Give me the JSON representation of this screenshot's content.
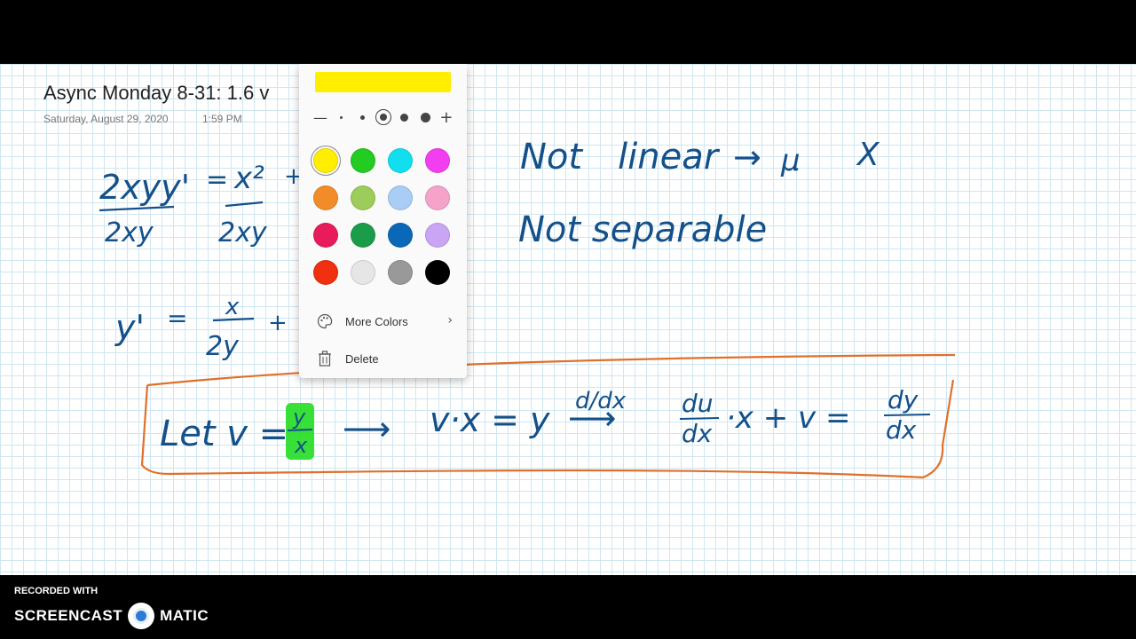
{
  "page": {
    "title": "Async Monday 8-31: 1.6 v",
    "date": "Saturday, August 29, 2020",
    "time": "1:59 PM"
  },
  "ink": {
    "eq1_left": "2xyy'",
    "eq1_eq": "=",
    "eq1_right": "x²",
    "eq1_plus": "+",
    "eq1_den_left": "2xy",
    "eq1_den_right": "2xy",
    "eq2_left": "y'",
    "eq2_eq": "=",
    "eq2_num": "x",
    "eq2_den": "2y",
    "eq2_plus": "+",
    "note1_a": "Not",
    "note1_b": "linear",
    "note1_arrow": "→",
    "note1_mu": "μ",
    "note1_x": "X",
    "note2": "Not separable",
    "box_let": "Let v =",
    "box_y": "y",
    "box_x": "x",
    "box_arrow1": "⟶",
    "box_vx": "v·x = y",
    "box_ddx": "d/dx",
    "box_arrow2": "⟶",
    "box_du": "du",
    "box_dx1": "dx",
    "box_rest": "·x + v =",
    "box_dy": "dy",
    "box_dx2": "dx"
  },
  "pen_picker": {
    "preview_color": "#ffee00",
    "thickness": {
      "decrease": "—",
      "increase": "+",
      "selected_index": 2
    },
    "swatches": [
      {
        "name": "yellow",
        "color": "#ffee00",
        "selected": true
      },
      {
        "name": "green",
        "color": "#22cc22"
      },
      {
        "name": "cyan",
        "color": "#11dff0"
      },
      {
        "name": "magenta",
        "color": "#f23ef0"
      },
      {
        "name": "orange",
        "color": "#f28c28"
      },
      {
        "name": "light-green",
        "color": "#9ccc5a"
      },
      {
        "name": "light-blue",
        "color": "#a9cdf5"
      },
      {
        "name": "pink",
        "color": "#f5a3c9"
      },
      {
        "name": "crimson",
        "color": "#e81c5a"
      },
      {
        "name": "dark-green",
        "color": "#1a9c4a"
      },
      {
        "name": "blue",
        "color": "#0a68b8"
      },
      {
        "name": "lavender",
        "color": "#c9a6f5"
      },
      {
        "name": "red",
        "color": "#f0300e"
      },
      {
        "name": "light-gray",
        "color": "#e6e6e6"
      },
      {
        "name": "gray",
        "color": "#999999"
      },
      {
        "name": "black",
        "color": "#000000"
      }
    ],
    "more_colors_label": "More Colors",
    "delete_label": "Delete"
  },
  "footer": {
    "recorded_with": "RECORDED WITH",
    "brand_left": "SCREENCAST",
    "brand_right": "MATIC"
  },
  "colors": {
    "ink": "#14508a",
    "box_stroke": "#e0702a",
    "highlight": "#22dd22",
    "grid": "#cfe6f1"
  }
}
